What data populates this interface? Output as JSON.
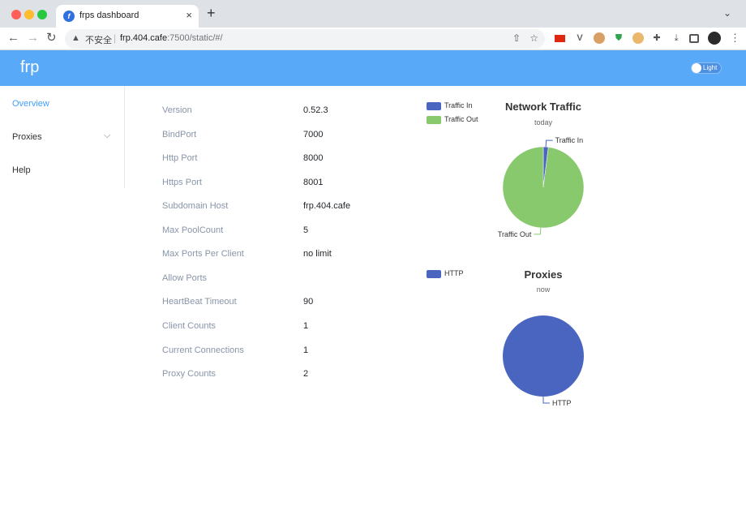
{
  "browser": {
    "tab_title": "frps dashboard",
    "tab_close": "×",
    "new_tab": "+",
    "tab_menu": "⌄",
    "security_label": "不安全",
    "url_host": "frp.404.cafe",
    "url_rest": ":7500/static/#/"
  },
  "app": {
    "brand": "frp",
    "theme_label": "Light"
  },
  "sidebar": {
    "items": [
      {
        "label": "Overview",
        "active": true
      },
      {
        "label": "Proxies",
        "expandable": true
      },
      {
        "label": "Help"
      }
    ]
  },
  "server_info": [
    {
      "label": "Version",
      "value": "0.52.3"
    },
    {
      "label": "BindPort",
      "value": "7000"
    },
    {
      "label": "Http Port",
      "value": "8000"
    },
    {
      "label": "Https Port",
      "value": "8001"
    },
    {
      "label": "Subdomain Host",
      "value": "frp.404.cafe"
    },
    {
      "label": "Max PoolCount",
      "value": "5"
    },
    {
      "label": "Max Ports Per Client",
      "value": "no limit"
    },
    {
      "label": "Allow Ports",
      "value": ""
    },
    {
      "label": "HeartBeat Timeout",
      "value": "90"
    },
    {
      "label": "Client Counts",
      "value": "1"
    },
    {
      "label": "Current Connections",
      "value": "1"
    },
    {
      "label": "Proxy Counts",
      "value": "2"
    }
  ],
  "colors": {
    "header": "#58a9f8",
    "traffic_in": "#4a65bf",
    "traffic_out": "#88c96d",
    "http": "#4a65bf",
    "active_link": "#409eff"
  },
  "chart_data": [
    {
      "type": "pie",
      "title": "Network Traffic",
      "subtitle": "today",
      "legend_position": "top-left",
      "slices": [
        {
          "name": "Traffic In",
          "value": 2
        },
        {
          "name": "Traffic Out",
          "value": 98
        }
      ]
    },
    {
      "type": "pie",
      "title": "Proxies",
      "subtitle": "now",
      "legend_position": "top-left",
      "slices": [
        {
          "name": "HTTP",
          "value": 100
        }
      ]
    }
  ]
}
